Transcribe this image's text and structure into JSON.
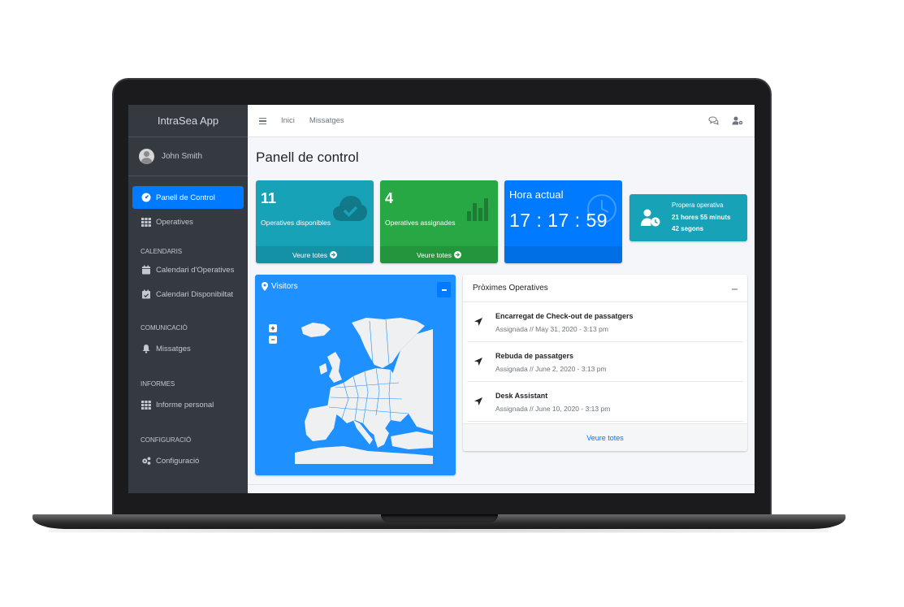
{
  "app": {
    "brand": "IntraSea App"
  },
  "user": {
    "name": "John Smith"
  },
  "sidebar": {
    "items": [
      {
        "label": "Panell de Control",
        "icon": "tachometer-icon"
      },
      {
        "label": "Operatives",
        "icon": "grid-icon"
      }
    ],
    "sections": [
      {
        "header": "CALENDARIS",
        "items": [
          {
            "label": "Calendari d'Operatives",
            "icon": "calendar-icon"
          },
          {
            "label": "Calendari Disponibiltat",
            "icon": "calendar-check-icon"
          }
        ]
      },
      {
        "header": "COMUNICACIÓ",
        "items": [
          {
            "label": "Missatges",
            "icon": "bell-icon"
          }
        ]
      },
      {
        "header": "INFORMES",
        "items": [
          {
            "label": "Informe personal",
            "icon": "grid-icon"
          }
        ]
      },
      {
        "header": "CONFIGURACIÓ",
        "items": [
          {
            "label": "Configuració",
            "icon": "cogs-icon"
          }
        ]
      }
    ]
  },
  "topbar": {
    "links": [
      "Inici",
      "Missatges"
    ]
  },
  "page": {
    "title": "Panell de control"
  },
  "boxes": [
    {
      "value": "11",
      "label": "Operatives disponibles",
      "footer": "Veure totes",
      "color": "#17a2b8"
    },
    {
      "value": "4",
      "label": "Operatives assignades",
      "footer": "Veure totes",
      "color": "#28a745"
    }
  ],
  "clock": {
    "title": "Hora actual",
    "time": "17 : 17 : 59",
    "color": "#007bff"
  },
  "next_op": {
    "title": "Propera operativa",
    "line1": "21 hores 55 minuts",
    "line2": "42 segons",
    "color": "#17a2b8"
  },
  "visitors": {
    "title": "Visitors"
  },
  "upcoming": {
    "title": "Pròximes Operatives",
    "items": [
      {
        "name": "Encarregat de Check-out de passatgers",
        "meta": "Assignada // May 31, 2020 - 3:13 pm"
      },
      {
        "name": "Rebuda de passatgers",
        "meta": "Assignada // June 2, 2020 - 3:13 pm"
      },
      {
        "name": "Desk Assistant",
        "meta": "Assignada // June 10, 2020 - 3:13 pm"
      }
    ],
    "footer": "Veure totes"
  }
}
